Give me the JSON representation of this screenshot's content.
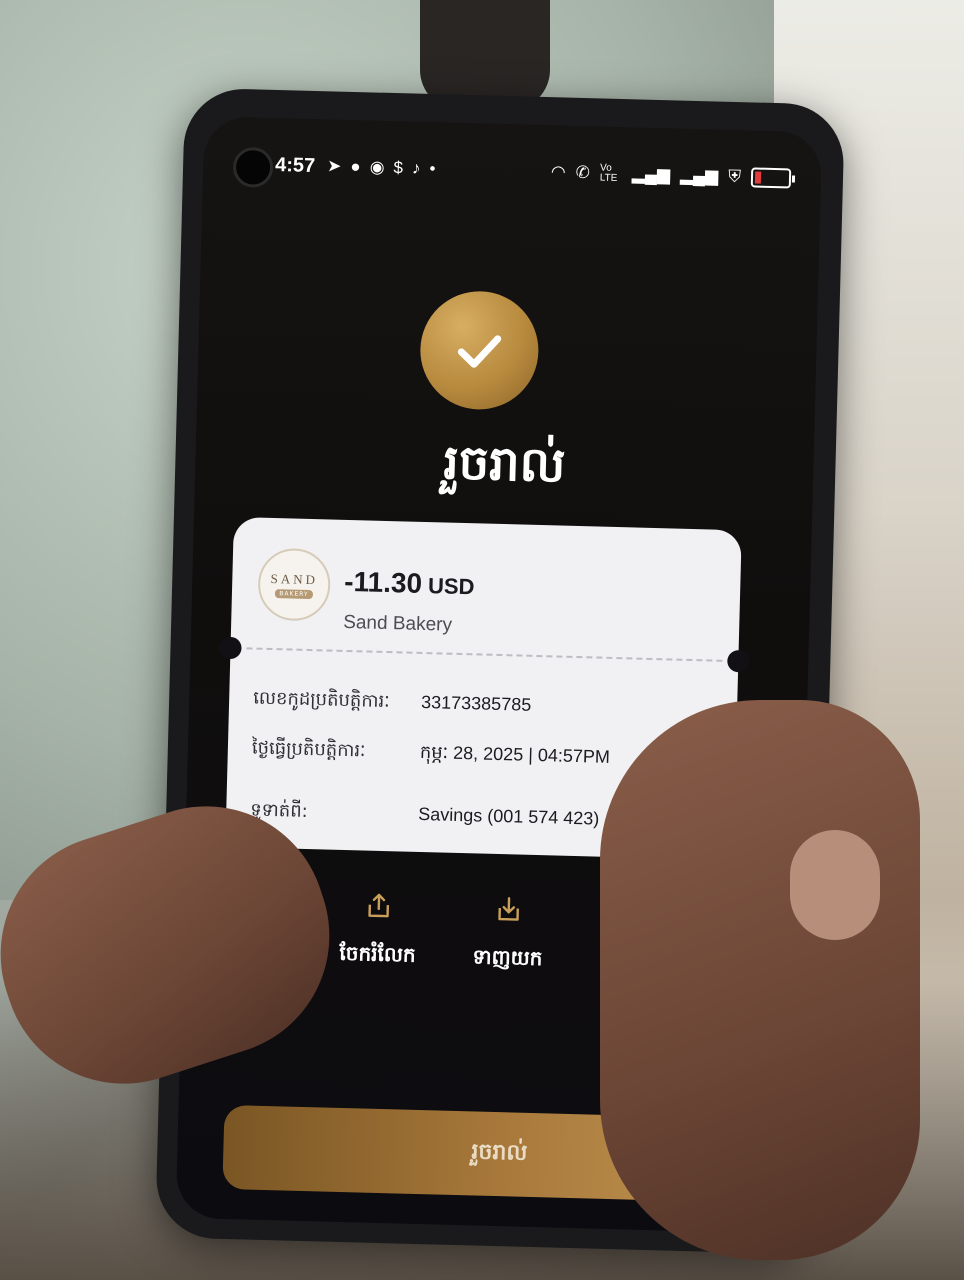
{
  "status_bar": {
    "time": "4:57",
    "left_icons": [
      "telegram-icon",
      "chat-icon",
      "messenger-icon",
      "dollar-icon",
      "tiktok-icon",
      "dot-icon"
    ],
    "right_icons": [
      "wifi-icon",
      "wifi-calling-icon",
      "volte-icon",
      "signal-icon",
      "signal-icon",
      "shield-icon",
      "battery-low-icon"
    ],
    "volte_label": "Vo LTE"
  },
  "header": {
    "success_icon": "checkmark-icon",
    "title": "រួចរាល់"
  },
  "receipt": {
    "merchant_logo_text": "SAND",
    "merchant_logo_subtext": "BAKERY",
    "amount": "-11.30",
    "currency": "USD",
    "merchant_name": "Sand Bakery",
    "transaction_id_label": "លេខកូដប្រតិបត្តិការៈ",
    "transaction_id": "33173385785",
    "transaction_date_label": "ថ្ងៃធ្វើប្រតិបត្តិការៈ",
    "transaction_date": "កុម្ភៈ 28, 2025 | 04:57PM",
    "paid_from_label": "ទូទាត់ពី:",
    "paid_from": "Savings (001 574 423)"
  },
  "actions": {
    "share_label": "ចែករំលែក",
    "download_label": "ទាញយក"
  },
  "footer": {
    "done_label": "រួចរាល់"
  },
  "colors": {
    "gold": "#b78a3e",
    "screen_bg": "#100e0d",
    "card_bg": "#f1f1f3"
  }
}
